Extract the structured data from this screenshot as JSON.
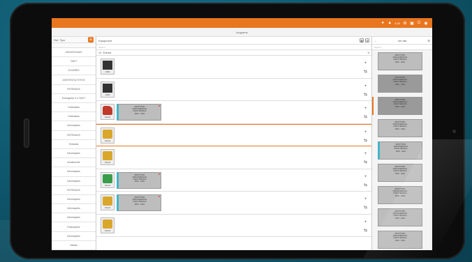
{
  "topbar": {
    "status_text": "4:00",
    "icons": [
      "bulb-icon",
      "alert-icon",
      "gear-icon",
      "save-icon",
      "power-icon",
      "logo-icon"
    ]
  },
  "subbar": {
    "title": "Isograms"
  },
  "left": {
    "header": "Ref. Tipo",
    "categories": [
      "AUDIOVISUAIS",
      "TAKIT",
      "OLHARES",
      "ASSITENTIA FOTOS",
      "ENTRADAS",
      "Entregando 3 e TAKIT",
      "Ordenadas",
      "Ordenadas",
      "Informações",
      "ENTRADAS",
      "Entradas",
      "Informações",
      "Inicialmente",
      "Informações",
      "Informações",
      "ENTRADAS",
      "Informações",
      "Informações",
      "Informações",
      "Publicações",
      "Informações",
      "Saídas"
    ]
  },
  "middle": {
    "header": "Equipment",
    "search_placeholder": "Search",
    "label": "10 - Everest",
    "rows": [
      {
        "thumb": "dark",
        "cap": "CAPA",
        "card": null
      },
      {
        "thumb": "dark",
        "cap": "CAPA",
        "card": null
      },
      {
        "thumb": "shoe",
        "cap": "CALÇA",
        "card": [
          "PROTÓTIPO",
          "CIMA ESSENCIAL",
          "FICHA TÉCNICA",
          "ISSO · 01/01"
        ]
      },
      {
        "thumb": "yellow",
        "cap": "CALÇA",
        "card": null
      },
      {
        "thumb": "yellow",
        "cap": "CALÇA",
        "card": null
      },
      {
        "thumb": "green",
        "cap": "CALÇA",
        "card": [
          "PROTÓTIPO",
          "CIMA ESSENCIAL",
          "FICHA TÉCNICA",
          "ISSO · 01/01"
        ]
      },
      {
        "thumb": "yellow",
        "cap": "CALÇA",
        "card": [
          "PROTÓTIPO",
          "CIMA ESSENCIAL",
          "FICHA TÉCNICA",
          "ISSO · 01/01"
        ]
      },
      {
        "thumb": "yellow",
        "cap": "CALÇA",
        "card": null
      }
    ],
    "action_add": "+",
    "action_link": "⇆"
  },
  "right": {
    "header": "Ver tab",
    "search_placeholder": "Search",
    "cards": [
      {
        "lines": [
          "PROTÓTIPO",
          "CIMA ESSENCIAL",
          "FICHA TÉCNICA",
          "ISSO · 01/01"
        ],
        "style": "normal"
      },
      {
        "lines": [
          "PROTÓTIPO",
          "CIMA ESSENCIAL",
          "FICHA TÉCNICA",
          "ISSO · 01/01"
        ],
        "style": "dark"
      },
      {
        "lines": [
          "PROTÓTIPO",
          "CIMA ESSENCIAL",
          "FICHA TÉCNICA",
          "ISSO · 01/01"
        ],
        "style": "dark"
      },
      {
        "lines": [
          "PROTÓTIPO",
          "CIMA ESSENCIAL",
          "FICHA TÉCNICA",
          "ISSO · 01/01"
        ],
        "style": "normal"
      },
      {
        "lines": [
          "PROTÓTIPO",
          "CIMA ESSENCIAL",
          "FICHA TÉCNICA",
          "ISSO · 01/01"
        ],
        "style": "teal"
      },
      {
        "lines": [
          "PROTÓTIPO",
          "CIMA ESSENCIAL",
          "FICHA TÉCNICA",
          "ISSO · 01/01"
        ],
        "style": "normal"
      },
      {
        "lines": [
          "PROTÓTIPO",
          "CIMA ESSENCIAL",
          "FICHA TÉCNICA",
          "ISSO · 01/01"
        ],
        "style": "normal"
      },
      {
        "lines": [
          "PROTÓTIPO",
          "CIMA ESSENCIAL",
          "FICHA TÉCNICA",
          "ISSO · 01/01"
        ],
        "style": "normal"
      },
      {
        "lines": [
          "PROTÓTIPO",
          "CIMA ESSENCIAL",
          "FICHA TÉCNICA",
          "ISSO · 01/01"
        ],
        "style": "normal"
      }
    ],
    "accent": "#e8761f",
    "teal": "#3fb6c9"
  }
}
